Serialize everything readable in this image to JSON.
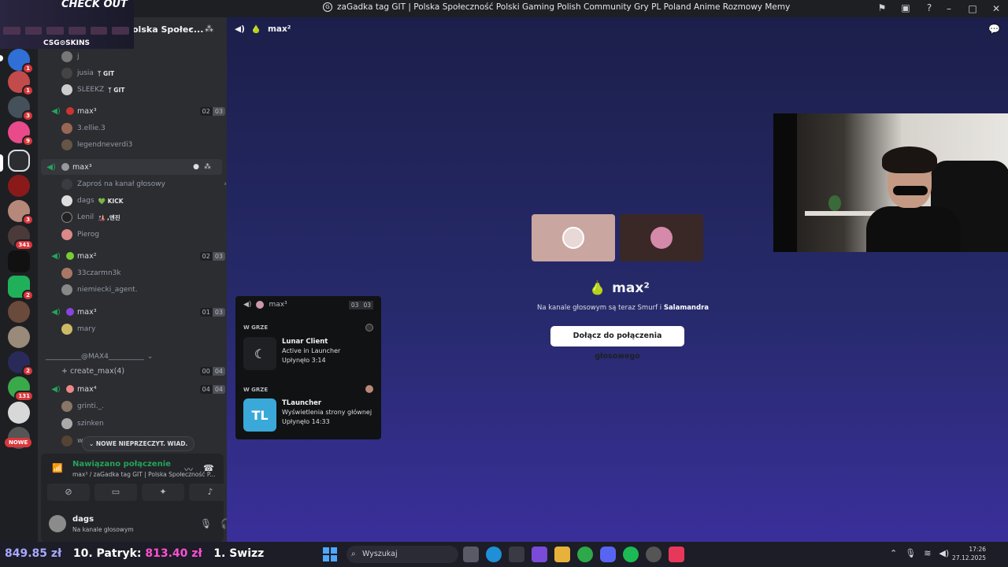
{
  "window": {
    "title": "zaGadka tag GIT | Polska Społeczność Polski Gaming Polish Community Gry PL Poland Anime Rozmowy Memy",
    "controls": [
      "–",
      "□",
      "✕"
    ]
  },
  "ad": {
    "title": "CHECK OUT",
    "brand": "CSG⊙SKINS"
  },
  "guild": {
    "name": "olska Społec..."
  },
  "servers": {
    "badges": [
      "1",
      "1",
      "3",
      "9",
      "3",
      "2",
      "341",
      "2",
      "131"
    ],
    "new_label": "NOWE"
  },
  "channels": {
    "top_users": [
      {
        "name": "j",
        "tag": ""
      },
      {
        "name": "jusia",
        "tag": "ᛉ GIT"
      },
      {
        "name": "SLEEKZ",
        "tag": "ᛉ GIT"
      }
    ],
    "vc1": {
      "name": "max³",
      "count_a": "02",
      "count_b": "03",
      "users": [
        "3.ellie.3",
        "legendneverdi3"
      ]
    },
    "vc2": {
      "name": "max³",
      "invite": "Zaproś na kanał głosowy",
      "users": [
        {
          "name": "dags",
          "tag": "💚 KICK"
        },
        {
          "name": "Lenil",
          "tag": "🎎 ,엔진"
        },
        {
          "name": "Pierog",
          "tag": ""
        }
      ]
    },
    "vc3": {
      "name": "max²",
      "count_a": "02",
      "count_b": "03",
      "users": [
        "33czarmn3k",
        "niemiecki_agent."
      ]
    },
    "vc4": {
      "name": "max³",
      "count_a": "01",
      "count_b": "03",
      "users": [
        "mary"
      ]
    },
    "category": "__________@MAX4__________",
    "create": {
      "name": "+ create_max(4)",
      "count_a": "00",
      "count_b": "04"
    },
    "vc5": {
      "name": "max⁴",
      "count_a": "04",
      "count_b": "04",
      "users": [
        "grinti._.",
        "szinken",
        "w"
      ]
    },
    "new_messages": "NOWE NIEPRZECZYT. WIAD."
  },
  "voice_panel": {
    "status": "Nawiązano połączenie",
    "subtitle": "max³ / zaGadka tag GIT | Polska Społeczność P...",
    "user": {
      "name": "dags",
      "status": "Na kanale głosowym"
    }
  },
  "main": {
    "channel": "max²",
    "stage_name": "max²",
    "stage_sub_prefix": "Na kanale głosowym są teraz Smurf i ",
    "stage_sub_bold": "Salamandra",
    "join_label": "Dołącz do połączenia głosowego"
  },
  "popout": {
    "channel": "max³",
    "count_a": "03",
    "count_b": "03",
    "activities": [
      {
        "section": "W GRZE",
        "icon": "",
        "title": "Lunar Client",
        "line1": "Active in Launcher",
        "line2": "Upłynęło 3:14"
      },
      {
        "section": "W GRZE",
        "icon": "TL",
        "title": "TLauncher",
        "line1": "Wyświetlenia strony głównej",
        "line2": "Upłynęło 14:33"
      }
    ]
  },
  "taskbar": {
    "money1": "849.85 zł",
    "rank": "10. Patryk:",
    "money2": "813.40 zł",
    "rank2": "1. Swizz",
    "search": "Wyszukaj",
    "time": "17:26",
    "date": "27.12.2025"
  },
  "colors": {
    "accent_green": "#23a55a",
    "badge_red": "#da373c",
    "sidebar": "#2b2d31",
    "server_bar": "#1e1f22"
  }
}
